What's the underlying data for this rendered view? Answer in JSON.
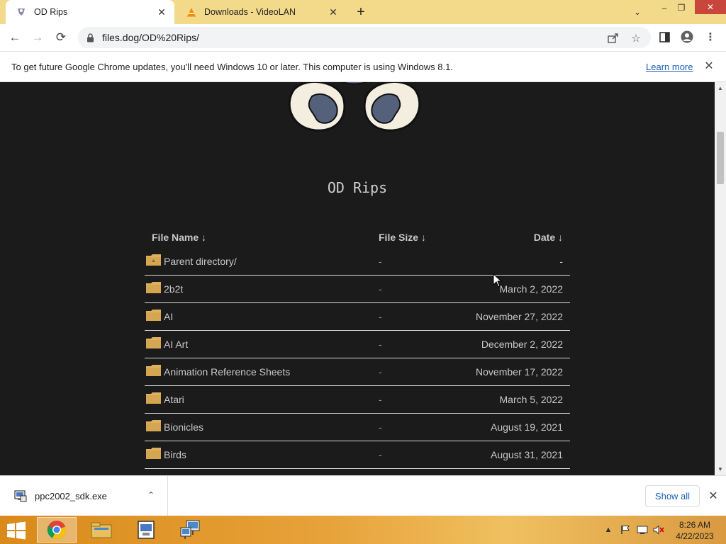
{
  "browser": {
    "tabs": [
      {
        "title": "OD Rips",
        "active": true,
        "icon": "od-rips-favicon"
      },
      {
        "title": "Downloads - VideoLAN",
        "active": false,
        "icon": "vlc-cone-icon"
      }
    ],
    "new_tab": "+",
    "window_controls": {
      "tab_search": "⌄",
      "minimize": "–",
      "restore": "❐",
      "close": "✕"
    },
    "nav": {
      "back": "←",
      "forward": "→",
      "reload": "⟳"
    },
    "address": {
      "url": "files.dog/OD%20Rips/"
    },
    "toolbar_icons": [
      "share-icon",
      "bookmark-star-icon",
      "side-panel-icon",
      "profile-icon",
      "menu-icon"
    ]
  },
  "infobar": {
    "message": "To get future Google Chrome updates, you'll need Windows 10 or later. This computer is using Windows 8.1.",
    "link": "Learn more",
    "close": "✕"
  },
  "page": {
    "title": "OD Rips",
    "headers": {
      "name": "File Name  ↓",
      "size": "File Size  ↓",
      "date": "Date  ↓"
    },
    "rows": [
      {
        "name": "Parent directory/",
        "size": "-",
        "date": "-"
      },
      {
        "name": "2b2t",
        "size": "-",
        "date": "March 2, 2022"
      },
      {
        "name": "AI",
        "size": "-",
        "date": "November 27, 2022"
      },
      {
        "name": "AI Art",
        "size": "-",
        "date": "December 2, 2022"
      },
      {
        "name": "Animation Reference Sheets",
        "size": "-",
        "date": "November 17, 2022"
      },
      {
        "name": "Atari",
        "size": "-",
        "date": "March 5, 2022"
      },
      {
        "name": "Bionicles",
        "size": "-",
        "date": "August 19, 2021"
      },
      {
        "name": "Birds",
        "size": "-",
        "date": "August 31, 2021"
      }
    ]
  },
  "download_bar": {
    "file": "ppc2002_sdk.exe",
    "caret": "⌃",
    "show_all": "Show all",
    "close": "✕"
  },
  "taskbar": {
    "apps": [
      "chrome-icon",
      "file-explorer-icon",
      "sdk-installer-icon",
      "network-computer-icon"
    ],
    "time": "8:26 AM",
    "date": "4/22/2023"
  },
  "colors": {
    "tabstrip": "#f3d98a",
    "page_bg": "#1b1b1b",
    "link": "#1a5fb4",
    "folder": "#e0b060"
  }
}
